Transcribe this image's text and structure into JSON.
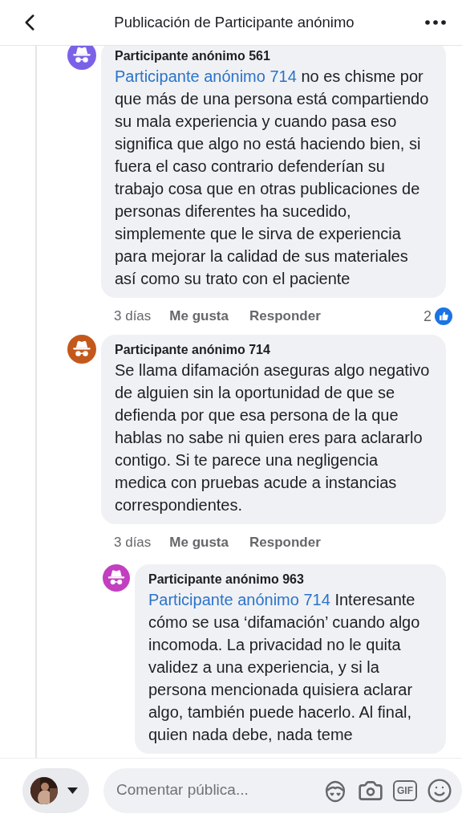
{
  "header": {
    "title": "Publicación de Participante anónimo"
  },
  "comments": [
    {
      "author": "Participante anónimo 561",
      "color": "#7b61e8",
      "mention": "Participante anónimo 714",
      "text": "no es chisme por que más de una persona está compartiendo su mala experiencia y cuando pasa eso significa que algo no está haciendo bien, si fuera el caso contrario defenderían su trabajo cosa que en otras publicaciones de personas diferentes ha sucedido, simplemente que le sirva de experiencia para mejorar la calidad de sus materiales así como su trato con el paciente",
      "time": "3 días",
      "like_label": "Me gusta",
      "reply_label": "Responder",
      "likes": "2"
    },
    {
      "author": "Participante anónimo 714",
      "color": "#c4581a",
      "text": "Se llama difamación aseguras algo negativo de alguien sin la oportunidad de que se defienda por que esa persona de la que hablas no sabe ni quien eres para aclararlo contigo. Si te parece una negligencia medica con pruebas acude a instancias correspondientes.",
      "time": "3 días",
      "like_label": "Me gusta",
      "reply_label": "Responder",
      "children": [
        {
          "author": "Participante anónimo 963",
          "color": "#c23fc0",
          "mention": "Participante anónimo 714",
          "text": "Interesante cómo se usa ‘difamación’ cuando algo incomoda. La privacidad no le quita validez a una experiencia, y si la persona mencionada quisiera aclarar algo, también puede hacerlo. Al final, quien nada debe, nada teme"
        }
      ]
    }
  ],
  "composer": {
    "placeholder": "Comentar pública...",
    "gif_label": "GIF"
  }
}
